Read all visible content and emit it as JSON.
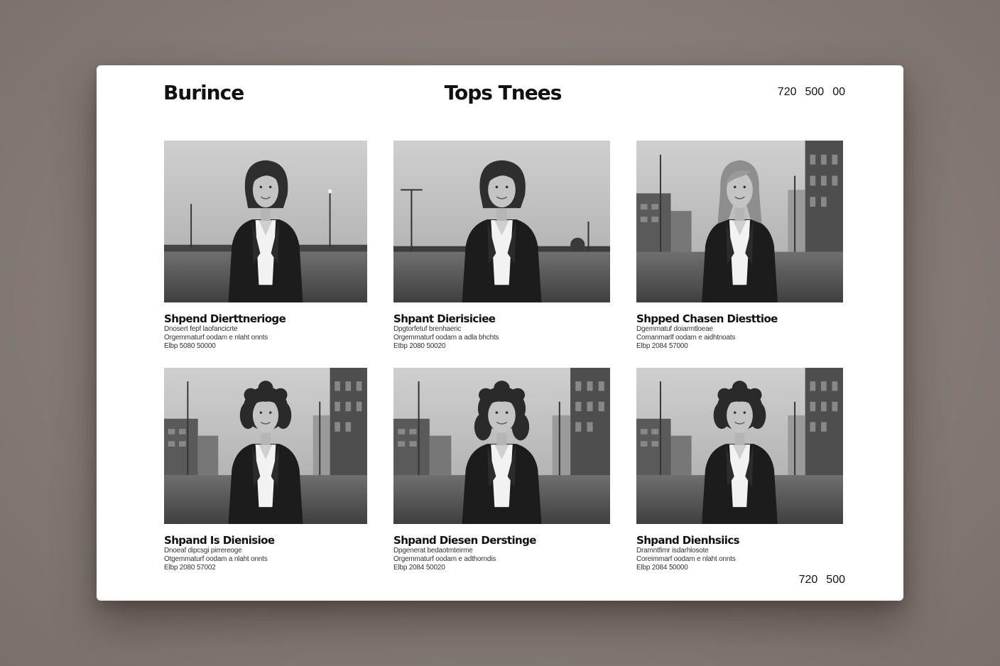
{
  "header": {
    "brand": "Burince",
    "title": "Tops Tnees",
    "stats": [
      "720",
      "500",
      "00"
    ]
  },
  "footer": {
    "stats": [
      "720",
      "500"
    ]
  },
  "cards": [
    {
      "title": "Shpend Dierttnerioge",
      "lines": [
        "Dnosert fepf laofancicrte",
        "Orgemmaturf oodam e nlaht onnts",
        "Elbp 5080 50000"
      ],
      "hair": "short-wavy",
      "scene": "open-road"
    },
    {
      "title": "Shpant Dierisiciee",
      "lines": [
        "Dpgtorfetuf brenhaeric",
        "Orgemmaturf oodam a adla bhchts",
        "Etbp 2080 50020"
      ],
      "hair": "short-wavy",
      "scene": "lamp-road"
    },
    {
      "title": "Shpped Chasen Diesttioe",
      "lines": [
        "Dgemmatuf doiarmtloeae",
        "Comanmarlf oodam e aidhtnoats",
        "Elbp 2084 57000"
      ],
      "hair": "long-straight",
      "scene": "city-street"
    },
    {
      "title": "Shpand Is Dienisioe",
      "lines": [
        "Dnoeaf dipcsgi pirrereoge",
        "Otgemmaturf oodam a nlaht onnts",
        "Elbp 2080 57002"
      ],
      "hair": "curly",
      "scene": "city-street"
    },
    {
      "title": "Shpand Diesen Derstinge",
      "lines": [
        "Dpgenerat bedaotmteirme",
        "Orgemmaturf oodam e adthorndis",
        "Elbp 2084 50020"
      ],
      "hair": "curly-long",
      "scene": "city-street"
    },
    {
      "title": "Shpand Dienhsiics",
      "lines": [
        "Dramntfimr isdarhlosote",
        "Coreimmarf oodam e nlaht onnts",
        "Elbp 2084 50000"
      ],
      "hair": "curly",
      "scene": "city-street"
    }
  ]
}
